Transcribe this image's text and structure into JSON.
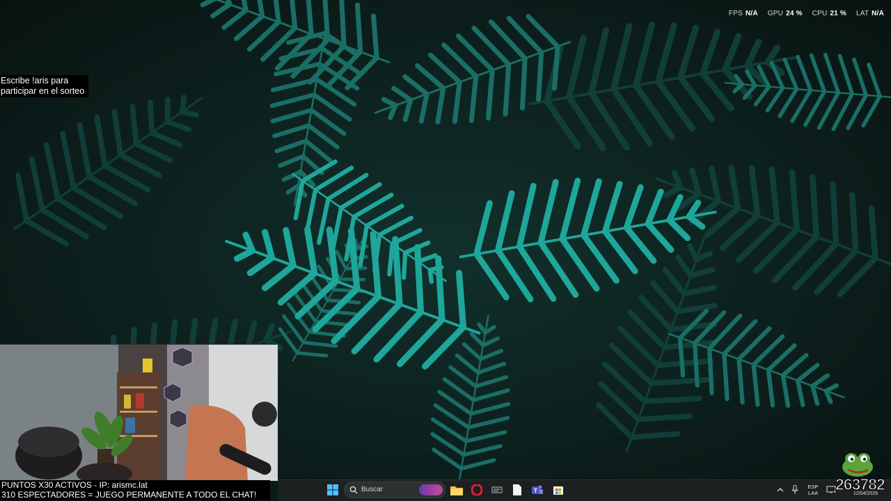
{
  "overlay": {
    "fps_label": "FPS",
    "fps_value": "N/A",
    "gpu_label": "GPU",
    "gpu_value": "24 %",
    "cpu_label": "CPU",
    "cpu_value": "21 %",
    "lat_label": "LAT",
    "lat_value": "N/A"
  },
  "giveaway": {
    "text": "Escribe !aris para participar en el sorteo"
  },
  "ticker": {
    "line1": "PUNTOS X30 ACTIVOS - IP: arismc.lat",
    "line2": "310 ESPECTADORES = JUEGO PERMANENTE A TODO EL CHAT!"
  },
  "taskbar": {
    "search_placeholder": "Buscar",
    "lang_line1": "ESP",
    "lang_line2": "LAA",
    "date": "12/04/2026"
  },
  "stream": {
    "counter": "263782"
  },
  "colors": {
    "fern": "#1fa69a",
    "taskbar": "#1c2020",
    "accent": "#0078d4"
  },
  "icons": [
    "windows-start-icon",
    "search-icon",
    "folder-icon",
    "opera-icon",
    "app-icon",
    "document-icon",
    "teams-icon",
    "store-icon",
    "chevron-up-icon",
    "microphone-icon",
    "monitor-icon",
    "speaker-icon"
  ]
}
